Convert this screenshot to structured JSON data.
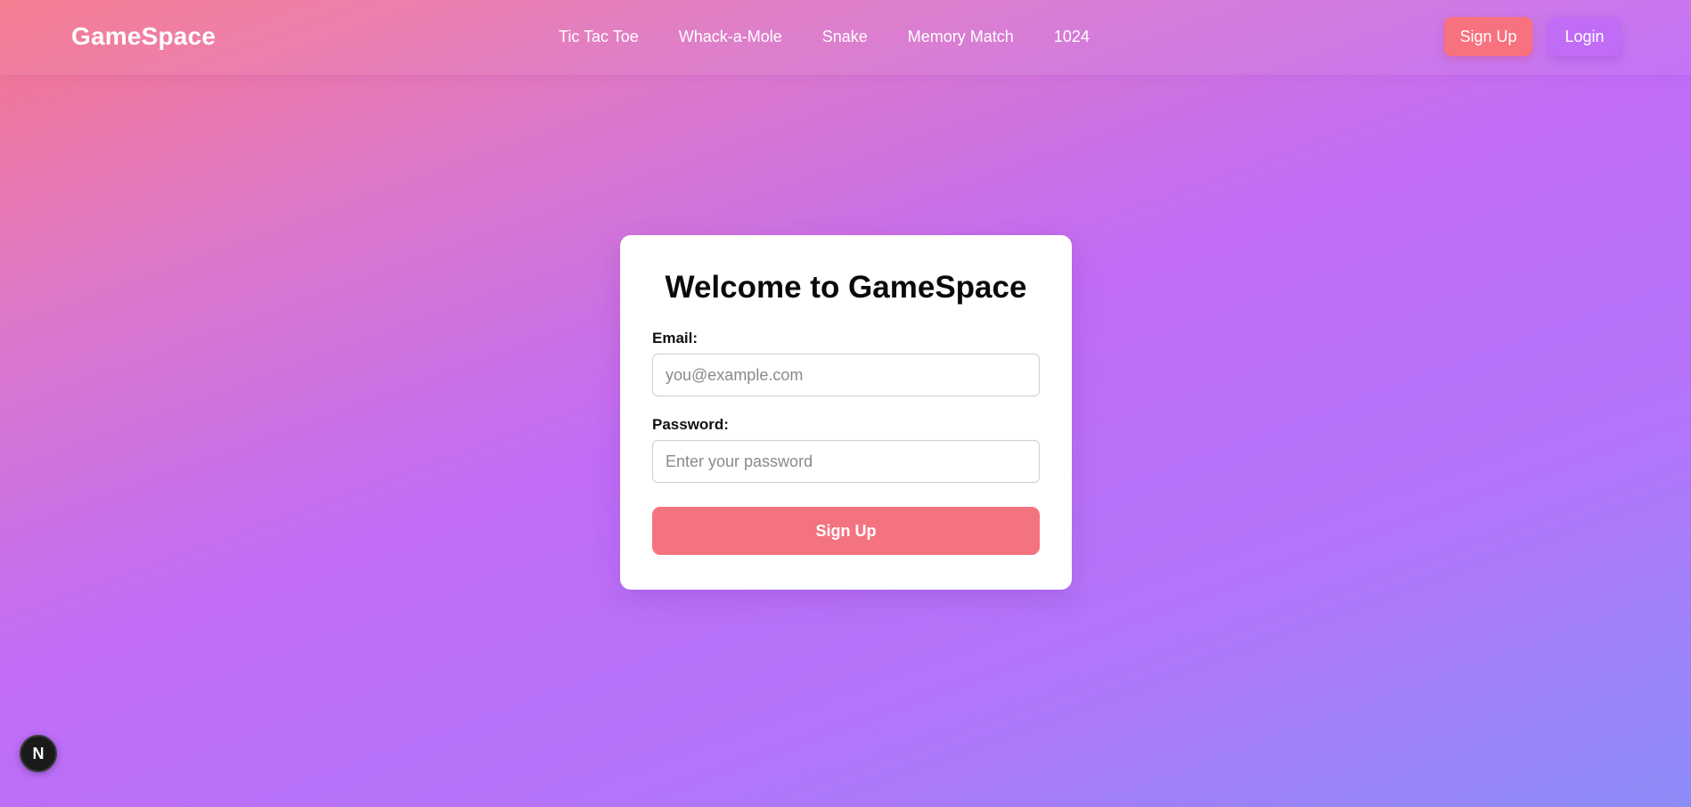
{
  "navbar": {
    "brand": "GameSpace",
    "links": [
      {
        "label": "Tic Tac Toe"
      },
      {
        "label": "Whack-a-Mole"
      },
      {
        "label": "Snake"
      },
      {
        "label": "Memory Match"
      },
      {
        "label": "1024"
      }
    ],
    "signup_label": "Sign Up",
    "login_label": "Login"
  },
  "form": {
    "title": "Welcome to GameSpace",
    "email_label": "Email:",
    "email_placeholder": "you@example.com",
    "email_value": "",
    "password_label": "Password:",
    "password_placeholder": "Enter your password",
    "password_value": "",
    "submit_label": "Sign Up"
  },
  "dev_badge": {
    "icon": "nextjs-logo-icon",
    "glyph": "N"
  },
  "colors": {
    "signup_accent": "#f7717f",
    "login_accent": "#c06cf7",
    "card_background": "#ffffff"
  }
}
